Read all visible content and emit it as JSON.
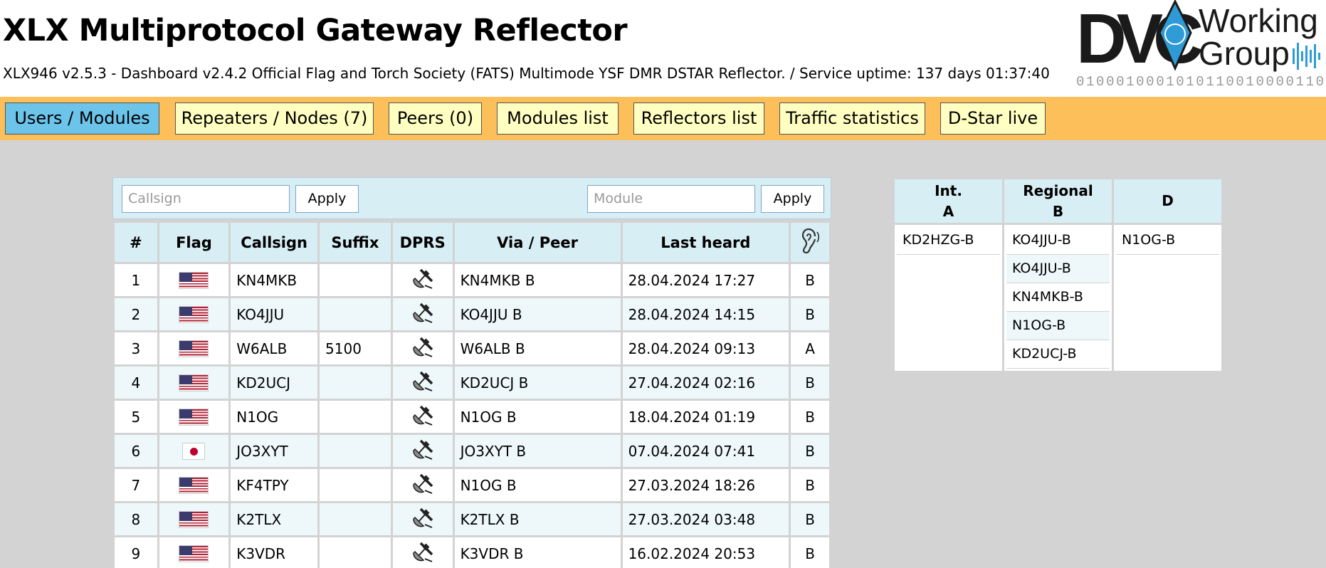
{
  "header": {
    "title": "XLX Multiprotocol Gateway Reflector",
    "subtitle": "XLX946 v2.5.3 - Dashboard v2.4.2 Official Flag and Torch Society (FATS) Multimode YSF DMR DSTAR Reflector.  /  Service uptime: 137 days 01:37:40",
    "logo": {
      "mark": "DVC",
      "line1": "Working",
      "line2": "Group",
      "binary": "0100010001010110010000110"
    }
  },
  "nav": [
    {
      "label": "Users / Modules",
      "active": true
    },
    {
      "label": "Repeaters / Nodes (7)",
      "active": false
    },
    {
      "label": "Peers (0)",
      "active": false
    },
    {
      "label": "Modules list",
      "active": false
    },
    {
      "label": "Reflectors list",
      "active": false
    },
    {
      "label": "Traffic statistics",
      "active": false
    },
    {
      "label": "D-Star live",
      "active": false
    }
  ],
  "filters": {
    "callsign_placeholder": "Callsign",
    "module_placeholder": "Module",
    "apply_label": "Apply"
  },
  "users_table": {
    "headers": [
      "#",
      "Flag",
      "Callsign",
      "Suffix",
      "DPRS",
      "Via / Peer",
      "Last heard",
      "listening-ear-icon"
    ],
    "rows": [
      {
        "n": "1",
        "flag": "us",
        "callsign": "KN4MKB",
        "suffix": "",
        "via": "KN4MKB B",
        "heard": "28.04.2024 17:27",
        "module": "B"
      },
      {
        "n": "2",
        "flag": "us",
        "callsign": "KO4JJU",
        "suffix": "",
        "via": "KO4JJU B",
        "heard": "28.04.2024 14:15",
        "module": "B"
      },
      {
        "n": "3",
        "flag": "us",
        "callsign": "W6ALB",
        "suffix": "5100",
        "via": "W6ALB B",
        "heard": "28.04.2024 09:13",
        "module": "A"
      },
      {
        "n": "4",
        "flag": "us",
        "callsign": "KD2UCJ",
        "suffix": "",
        "via": "KD2UCJ B",
        "heard": "27.04.2024 02:16",
        "module": "B"
      },
      {
        "n": "5",
        "flag": "us",
        "callsign": "N1OG",
        "suffix": "",
        "via": "N1OG B",
        "heard": "18.04.2024 01:19",
        "module": "B"
      },
      {
        "n": "6",
        "flag": "jp",
        "callsign": "JO3XYT",
        "suffix": "",
        "via": "JO3XYT B",
        "heard": "07.04.2024 07:41",
        "module": "B"
      },
      {
        "n": "7",
        "flag": "us",
        "callsign": "KF4TPY",
        "suffix": "",
        "via": "N1OG B",
        "heard": "27.03.2024 18:26",
        "module": "B"
      },
      {
        "n": "8",
        "flag": "us",
        "callsign": "K2TLX",
        "suffix": "",
        "via": "K2TLX B",
        "heard": "27.03.2024 03:48",
        "module": "B"
      },
      {
        "n": "9",
        "flag": "us",
        "callsign": "K3VDR",
        "suffix": "",
        "via": "K3VDR B",
        "heard": "16.02.2024 20:53",
        "module": "B"
      }
    ]
  },
  "modules": [
    {
      "name": "Int.",
      "letter": "A",
      "entries": [
        "KD2HZG-B"
      ]
    },
    {
      "name": "Regional",
      "letter": "B",
      "entries": [
        "KO4JJU-B",
        "KO4JJU-B",
        "KN4MKB-B",
        "N1OG-B",
        "KD2UCJ-B"
      ]
    },
    {
      "name": "",
      "letter": "D",
      "entries": [
        "N1OG-B"
      ]
    }
  ]
}
